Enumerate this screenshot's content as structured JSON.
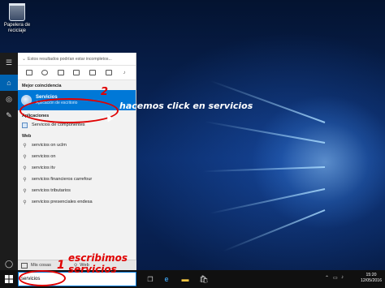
{
  "desktop": {
    "recycle_bin_label_1": "Papelera de",
    "recycle_bin_label_2": "reciclaje"
  },
  "search_panel": {
    "filter_hint": "Estos resultados podrían estar incompletos...",
    "filter_icons": [
      "app-icon",
      "settings-icon",
      "documents-icon",
      "folders-icon",
      "photos-icon",
      "videos-icon",
      "music-icon"
    ],
    "best_match_header": "Mejor coincidencia",
    "best_match": {
      "title": "Servicios",
      "subtitle": "Aplicación de escritorio"
    },
    "apps_header": "Aplicaciones",
    "apps": [
      "Servicios de componentes"
    ],
    "web_header": "Web",
    "web_results": [
      "servicios on uclm",
      "servicios on",
      "servicios itv",
      "servicios financieros carrefour",
      "servicios tributarios",
      "servicios presenciales endesa"
    ],
    "tab_my_stuff": "Mis cosas",
    "tab_web": "Web"
  },
  "taskbar": {
    "search_value": "servicios",
    "time": "15:20",
    "date": "12/05/2016"
  },
  "annotations": {
    "step1_number": "1",
    "step1_line1": "escribimos",
    "step1_line2": "servicios",
    "step2_number": "2",
    "step2_text": "hacemos click en servicios"
  },
  "colors": {
    "accent": "#0078d7",
    "annotation_red": "#e00000"
  }
}
